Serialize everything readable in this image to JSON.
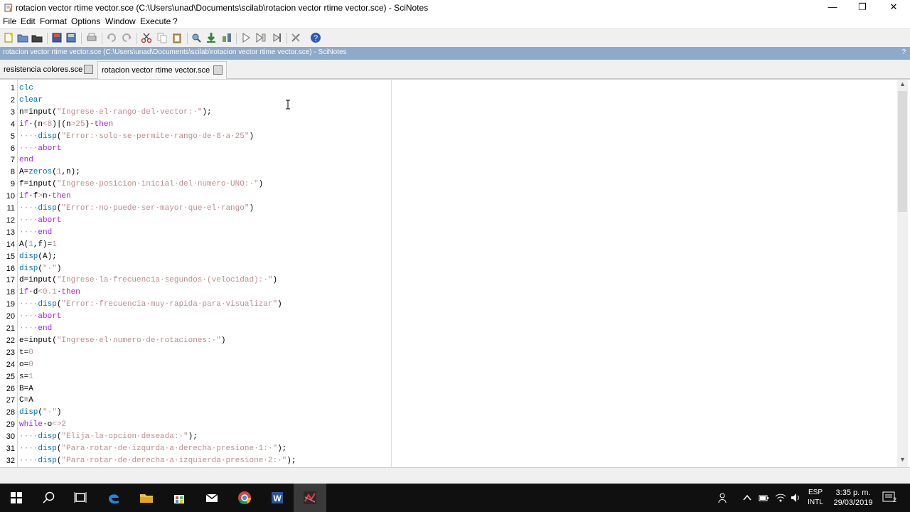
{
  "window": {
    "title": "rotacion vector rtime vector.sce (C:\\Users\\unad\\Documents\\scilab\\rotacion vector rtime vector.sce) - SciNotes",
    "minimize": "—",
    "maximize": "❐",
    "close": "✕"
  },
  "menu": [
    "File",
    "Edit",
    "Format",
    "Options",
    "Window",
    "Execute",
    "?"
  ],
  "infobar": {
    "text": "rotacion vector rtime vector.sce (C:\\Users\\unad\\Documents\\scilab\\rotacion vector rtime vector.sce) - SciNotes",
    "help": "?"
  },
  "tabs": [
    {
      "label": "resistencia colores.sce",
      "active": false
    },
    {
      "label": "rotacion vector rtime vector.sce",
      "active": true
    }
  ],
  "code_lines": [
    {
      "n": "1",
      "tokens": [
        [
          "fn",
          "clc"
        ]
      ]
    },
    {
      "n": "2",
      "tokens": [
        [
          "fn",
          "clear"
        ]
      ]
    },
    {
      "n": "3",
      "tokens": [
        [
          "plain",
          "n=input("
        ],
        [
          "str",
          "\"Ingrese·el·rango·del·vector:·\""
        ],
        [
          "plain",
          ");"
        ]
      ]
    },
    {
      "n": "4",
      "tokens": [
        [
          "kw",
          "if"
        ],
        [
          "plain",
          "·(n"
        ],
        [
          "num",
          "<8"
        ],
        [
          "plain",
          ")|(n"
        ],
        [
          "num",
          ">25"
        ],
        [
          "plain",
          ")·"
        ],
        [
          "kw",
          "then"
        ]
      ]
    },
    {
      "n": "5",
      "tokens": [
        [
          "str",
          "····"
        ],
        [
          "fn",
          "disp"
        ],
        [
          "plain",
          "("
        ],
        [
          "str",
          "\"Error:·solo·se·permite·rango·de·8·a·25\""
        ],
        [
          "plain",
          ")"
        ]
      ]
    },
    {
      "n": "6",
      "tokens": [
        [
          "str",
          "····"
        ],
        [
          "kw",
          "abort"
        ]
      ]
    },
    {
      "n": "7",
      "tokens": [
        [
          "kw",
          "end"
        ]
      ]
    },
    {
      "n": "8",
      "tokens": [
        [
          "plain",
          "A="
        ],
        [
          "fn",
          "zeros"
        ],
        [
          "plain",
          "("
        ],
        [
          "num",
          "1"
        ],
        [
          "plain",
          ",n);"
        ]
      ]
    },
    {
      "n": "9",
      "tokens": [
        [
          "plain",
          "f=input("
        ],
        [
          "str",
          "\"Ingrese·posicion·inicial·del·numero·UNO:·\""
        ],
        [
          "plain",
          ")"
        ]
      ]
    },
    {
      "n": "10",
      "tokens": [
        [
          "kw",
          "if"
        ],
        [
          "plain",
          "·f"
        ],
        [
          "num",
          ">"
        ],
        [
          "plain",
          "n·"
        ],
        [
          "kw",
          "then"
        ]
      ]
    },
    {
      "n": "11",
      "tokens": [
        [
          "str",
          "····"
        ],
        [
          "fn",
          "disp"
        ],
        [
          "plain",
          "("
        ],
        [
          "str",
          "\"Error:·no·puede·ser·mayor·que·el·rango\""
        ],
        [
          "plain",
          ")"
        ]
      ]
    },
    {
      "n": "12",
      "tokens": [
        [
          "str",
          "····"
        ],
        [
          "kw",
          "abort"
        ]
      ]
    },
    {
      "n": "13",
      "tokens": [
        [
          "str",
          "····"
        ],
        [
          "kw",
          "end"
        ]
      ]
    },
    {
      "n": "14",
      "tokens": [
        [
          "plain",
          "A("
        ],
        [
          "num",
          "1"
        ],
        [
          "plain",
          ",f)="
        ],
        [
          "num",
          "1"
        ]
      ]
    },
    {
      "n": "15",
      "tokens": [
        [
          "fn",
          "disp"
        ],
        [
          "plain",
          "(A);"
        ]
      ]
    },
    {
      "n": "16",
      "tokens": [
        [
          "fn",
          "disp"
        ],
        [
          "plain",
          "("
        ],
        [
          "str",
          "\"·\""
        ],
        [
          "plain",
          ")"
        ]
      ]
    },
    {
      "n": "17",
      "tokens": [
        [
          "plain",
          "d=input("
        ],
        [
          "str",
          "\"Ingrese·la·frecuencia·segundos·(velocidad):·\""
        ],
        [
          "plain",
          ")"
        ]
      ]
    },
    {
      "n": "18",
      "tokens": [
        [
          "kw",
          "if"
        ],
        [
          "plain",
          "·d"
        ],
        [
          "num",
          "<0.1"
        ],
        [
          "plain",
          "·"
        ],
        [
          "kw",
          "then"
        ]
      ]
    },
    {
      "n": "19",
      "tokens": [
        [
          "str",
          "····"
        ],
        [
          "fn",
          "disp"
        ],
        [
          "plain",
          "("
        ],
        [
          "str",
          "\"Error:·frecuencia·muy·rapida·para·visualizar\""
        ],
        [
          "plain",
          ")"
        ]
      ]
    },
    {
      "n": "20",
      "tokens": [
        [
          "str",
          "····"
        ],
        [
          "kw",
          "abort"
        ]
      ]
    },
    {
      "n": "21",
      "tokens": [
        [
          "str",
          "····"
        ],
        [
          "kw",
          "end"
        ]
      ]
    },
    {
      "n": "22",
      "tokens": [
        [
          "plain",
          "e=input("
        ],
        [
          "str",
          "\"Ingrese·el·numero·de·rotaciones:·\""
        ],
        [
          "plain",
          ")"
        ]
      ]
    },
    {
      "n": "23",
      "tokens": [
        [
          "plain",
          "t="
        ],
        [
          "num",
          "0"
        ]
      ]
    },
    {
      "n": "24",
      "tokens": [
        [
          "plain",
          "o="
        ],
        [
          "num",
          "0"
        ]
      ]
    },
    {
      "n": "25",
      "tokens": [
        [
          "plain",
          "s="
        ],
        [
          "num",
          "1"
        ]
      ]
    },
    {
      "n": "26",
      "tokens": [
        [
          "plain",
          "B=A"
        ]
      ]
    },
    {
      "n": "27",
      "tokens": [
        [
          "plain",
          "C=A"
        ]
      ]
    },
    {
      "n": "28",
      "tokens": [
        [
          "fn",
          "disp"
        ],
        [
          "plain",
          "("
        ],
        [
          "str",
          "\"·\""
        ],
        [
          "plain",
          ")"
        ]
      ]
    },
    {
      "n": "29",
      "tokens": [
        [
          "kw",
          "while"
        ],
        [
          "plain",
          "·o"
        ],
        [
          "num",
          "<>2"
        ]
      ]
    },
    {
      "n": "30",
      "tokens": [
        [
          "str",
          "····"
        ],
        [
          "fn",
          "disp"
        ],
        [
          "plain",
          "("
        ],
        [
          "str",
          "\"Elija·la·opcion·deseada:·\""
        ],
        [
          "plain",
          ");"
        ]
      ]
    },
    {
      "n": "31",
      "tokens": [
        [
          "str",
          "····"
        ],
        [
          "fn",
          "disp"
        ],
        [
          "plain",
          "("
        ],
        [
          "str",
          "\"Para·rotar·de·izqurda·a·derecha·presione·1:·\""
        ],
        [
          "plain",
          ");"
        ]
      ]
    },
    {
      "n": "32",
      "tokens": [
        [
          "str",
          "····"
        ],
        [
          "fn",
          "disp"
        ],
        [
          "plain",
          "("
        ],
        [
          "str",
          "\"Para·rotar·de·derecha·a·izquierda·presione·2:·\""
        ],
        [
          "plain",
          ");"
        ]
      ]
    }
  ],
  "taskbar": {
    "language": "ESP",
    "layout": "INTL",
    "time": "3:35 p. m.",
    "date": "29/03/2019",
    "notifications": "2"
  },
  "colors": {
    "infobar": "#8eaacb",
    "keyword": "#a020f0",
    "function": "#0070c0",
    "string": "#bc8f8f",
    "taskbar": "#101010"
  }
}
